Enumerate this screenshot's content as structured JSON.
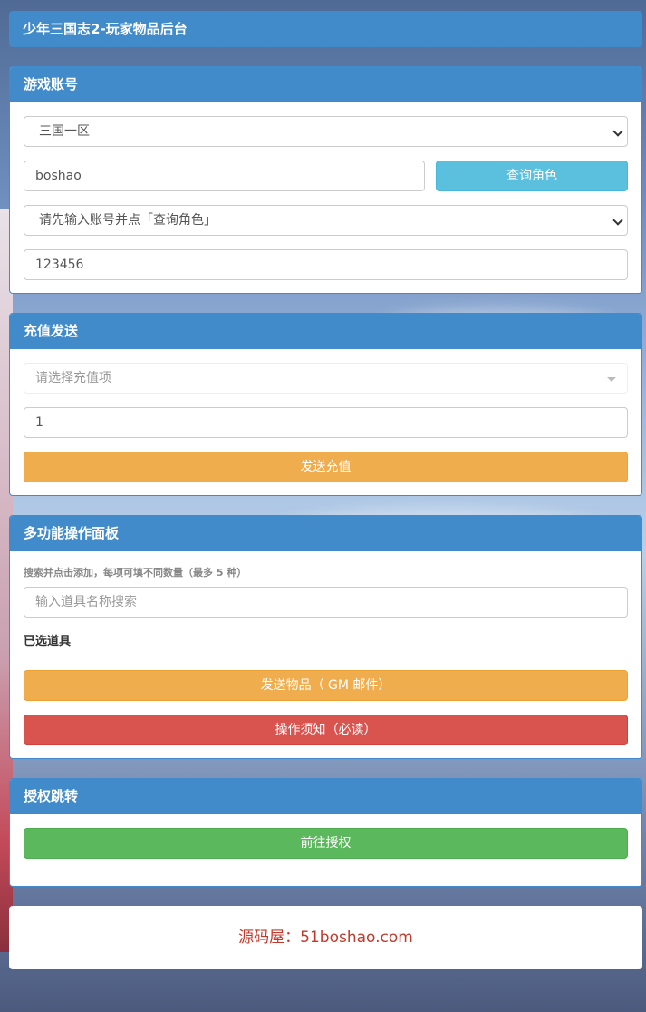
{
  "header": {
    "title": "少年三国志2-玩家物品后台"
  },
  "account_panel": {
    "title": "游戏账号",
    "server_select": "三国一区",
    "account_input": "boshao",
    "query_button": "查询角色",
    "role_select": "请先输入账号并点「查询角色」",
    "password_input": "123456"
  },
  "recharge_panel": {
    "title": "充值发送",
    "item_select_placeholder": "请选择充值项",
    "quantity_input": "1",
    "send_button": "发送充值"
  },
  "multi_panel": {
    "title": "多功能操作面板",
    "hint": "搜索并点击添加，每项可填不同数量（最多 5 种）",
    "search_placeholder": "输入道具名称搜索",
    "selected_label": "已选道具",
    "send_items_button": "发送物品（ GM 邮件）",
    "notice_button": "操作须知（必读）"
  },
  "auth_panel": {
    "title": "授权跳转",
    "goto_button": "前往授权"
  },
  "footer": {
    "text": "源码屋：51boshao.com"
  },
  "colors": {
    "primary": "#428bca",
    "info": "#5bc0de",
    "warning": "#f0ad4e",
    "danger": "#d9534f",
    "success": "#5cb85c",
    "footer_text": "#c0392b"
  }
}
